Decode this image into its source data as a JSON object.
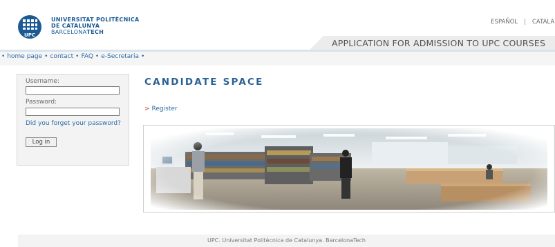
{
  "header": {
    "logo": {
      "line1": "UNIVERSITAT POLITÈCNICA",
      "line2": "DE CATALUNYA",
      "line3_prefix": "BARCELONA",
      "line3_bold": "TECH",
      "mark_text": "UPC"
    },
    "languages": [
      "ESPAÑOL",
      "CATALÀ"
    ],
    "language_separator": "|",
    "banner": "APPLICATION FOR ADMISSION TO UPC COURSES"
  },
  "nav": {
    "items": [
      "home page",
      "contact",
      "FAQ",
      "e-Secretaria"
    ],
    "separator": "•"
  },
  "login": {
    "username_label": "Username:",
    "username_value": "",
    "password_label": "Password:",
    "password_value": "",
    "forgot_link": "Did you forget your password?",
    "login_button": "Log in"
  },
  "main": {
    "title": "CANDIDATE SPACE",
    "register_marker": ">",
    "register_link": "Register"
  },
  "footer": {
    "text": "UPC. Universitat Politècnica de Catalunya. BarcelonaTech"
  },
  "colors": {
    "brand_blue": "#1b5a93",
    "link_blue": "#2c6aa6",
    "banner_gray": "#ececec"
  }
}
